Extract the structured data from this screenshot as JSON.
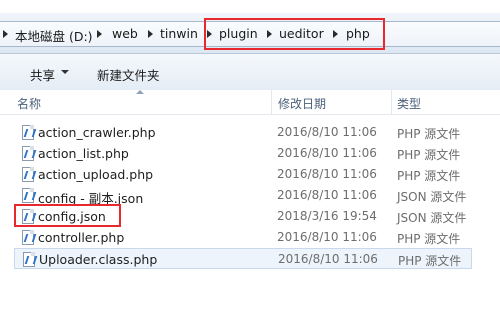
{
  "address": {
    "crumbs": [
      "本地磁盘 (D:)",
      "web",
      "tinwin",
      "plugin",
      "ueditor",
      "php"
    ]
  },
  "toolbar": {
    "share_label": "共享",
    "new_folder_label": "新建文件夹"
  },
  "columns": {
    "name": "名称",
    "date": "修改日期",
    "type": "类型"
  },
  "files": [
    {
      "name": "action_crawler.php",
      "date": "2016/8/10 11:06",
      "type": "PHP 源文件"
    },
    {
      "name": "action_list.php",
      "date": "2016/8/10 11:06",
      "type": "PHP 源文件"
    },
    {
      "name": "action_upload.php",
      "date": "2016/8/10 11:06",
      "type": "PHP 源文件"
    },
    {
      "name": "config - 副本.json",
      "date": "2016/8/10 11:06",
      "type": "JSON 源文件"
    },
    {
      "name": "config.json",
      "date": "2018/3/16 19:54",
      "type": "JSON 源文件"
    },
    {
      "name": "controller.php",
      "date": "2016/8/10 11:06",
      "type": "PHP 源文件"
    },
    {
      "name": "Uploader.class.php",
      "date": "2016/8/10 11:06",
      "type": "PHP 源文件"
    }
  ],
  "colors": {
    "highlight": "#e8282c",
    "selection": "#eef4fc"
  }
}
